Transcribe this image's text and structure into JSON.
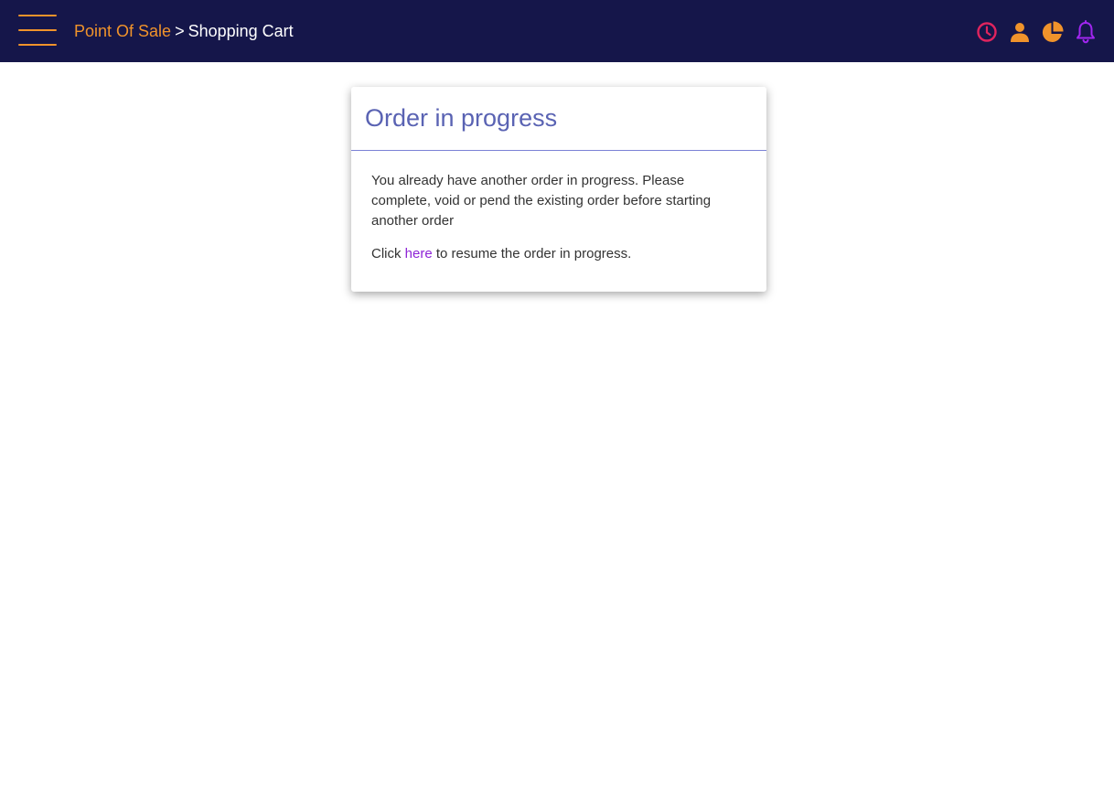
{
  "header": {
    "breadcrumb_root": "Point Of Sale",
    "breadcrumb_separator": ">",
    "breadcrumb_current": "Shopping Cart",
    "bg_color": "#15164a",
    "accent_color": "#f0932b",
    "icons": [
      "clock-icon",
      "user-icon",
      "pie-chart-icon",
      "bell-icon"
    ]
  },
  "dialog": {
    "title": "Order in progress",
    "message": "You already have another order in progress. Please complete, void or pend the existing order before starting another order",
    "resume_prefix": "Click",
    "resume_link": "here",
    "resume_suffix": "to resume the order in progress."
  }
}
